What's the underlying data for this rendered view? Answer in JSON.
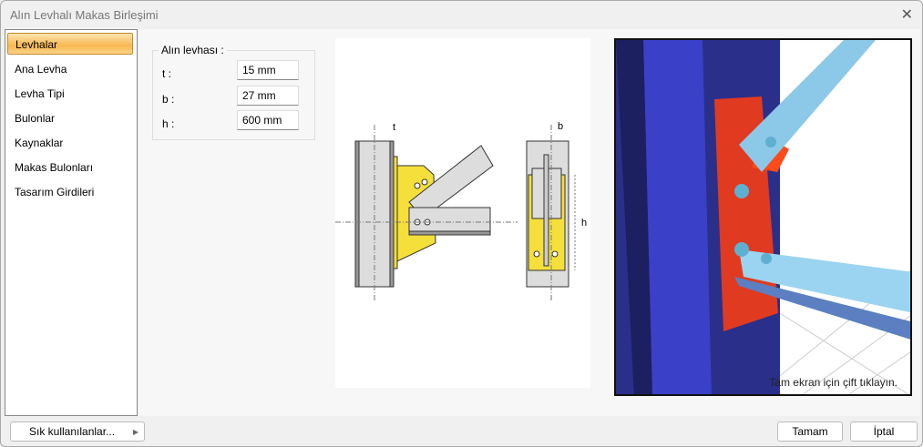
{
  "window": {
    "title": "Alın Levhalı Makas Birleşimi",
    "close": "✕"
  },
  "sidebar": {
    "items": [
      {
        "label": "Levhalar"
      },
      {
        "label": "Ana Levha"
      },
      {
        "label": "Levha Tipi"
      },
      {
        "label": "Bulonlar"
      },
      {
        "label": "Kaynaklar"
      },
      {
        "label": "Makas Bulonları"
      },
      {
        "label": "Tasarım Girdileri"
      }
    ]
  },
  "plate": {
    "group_label": "Alın levhası :",
    "fields": [
      {
        "label": "t :",
        "value": "15 mm"
      },
      {
        "label": "b :",
        "value": "27 mm"
      },
      {
        "label": "h :",
        "value": "600 mm"
      }
    ]
  },
  "drawing": {
    "dim_t": "t",
    "dim_b": "b",
    "dim_h": "h"
  },
  "view3d": {
    "hint": "Tam ekran için çift tıklayın."
  },
  "footer": {
    "favorites": "Sık kullanılanlar...",
    "ok": "Tamam",
    "cancel": "İptal"
  }
}
